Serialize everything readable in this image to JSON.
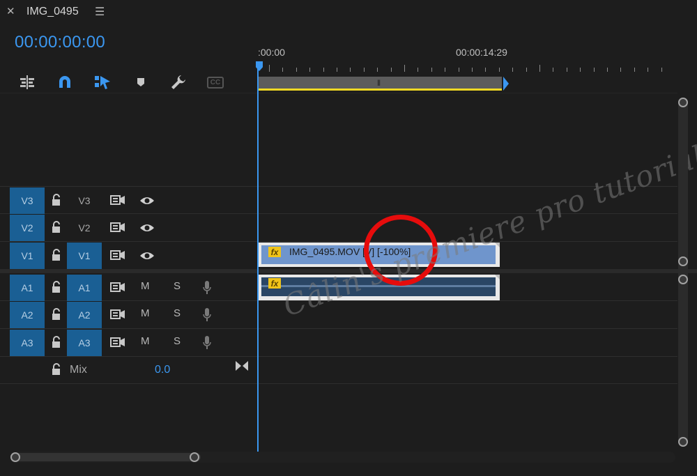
{
  "panel": {
    "close_icon": "close-icon",
    "title": "IMG_0495",
    "menu_icon": "hamburger-menu-icon"
  },
  "timecode": "00:00:00:00",
  "toolbar": {
    "icons": [
      "insert-nested-sequence-icon",
      "snap-magnet-icon",
      "linked-selection-icon",
      "add-marker-icon",
      "timeline-settings-wrench-icon",
      "closed-captions-icon"
    ],
    "cc_label": "CC",
    "accent": "#3b97f0"
  },
  "ruler": {
    "start_label": ":00:00",
    "mid_label": "00:00:14:29"
  },
  "tracks": {
    "video": [
      {
        "target": "V3",
        "source": "V3",
        "source_active": false
      },
      {
        "target": "V2",
        "source": "V2",
        "source_active": false
      },
      {
        "target": "V1",
        "source": "V1",
        "source_active": true
      }
    ],
    "audio": [
      {
        "target": "A1",
        "source": "A1",
        "m": "M",
        "s": "S"
      },
      {
        "target": "A2",
        "source": "A2",
        "m": "M",
        "s": "S"
      },
      {
        "target": "A3",
        "source": "A3",
        "m": "M",
        "s": "S"
      }
    ],
    "mix": {
      "label": "Mix",
      "value": "0.0"
    }
  },
  "clips": {
    "video": {
      "fx": "fx",
      "name": "IMG_0495.MOV [V] [-100%]"
    },
    "audio": {
      "fx": "fx"
    }
  },
  "annotation_color": "#e60c0c",
  "watermark": "Câlin's premiere pro tutorials"
}
